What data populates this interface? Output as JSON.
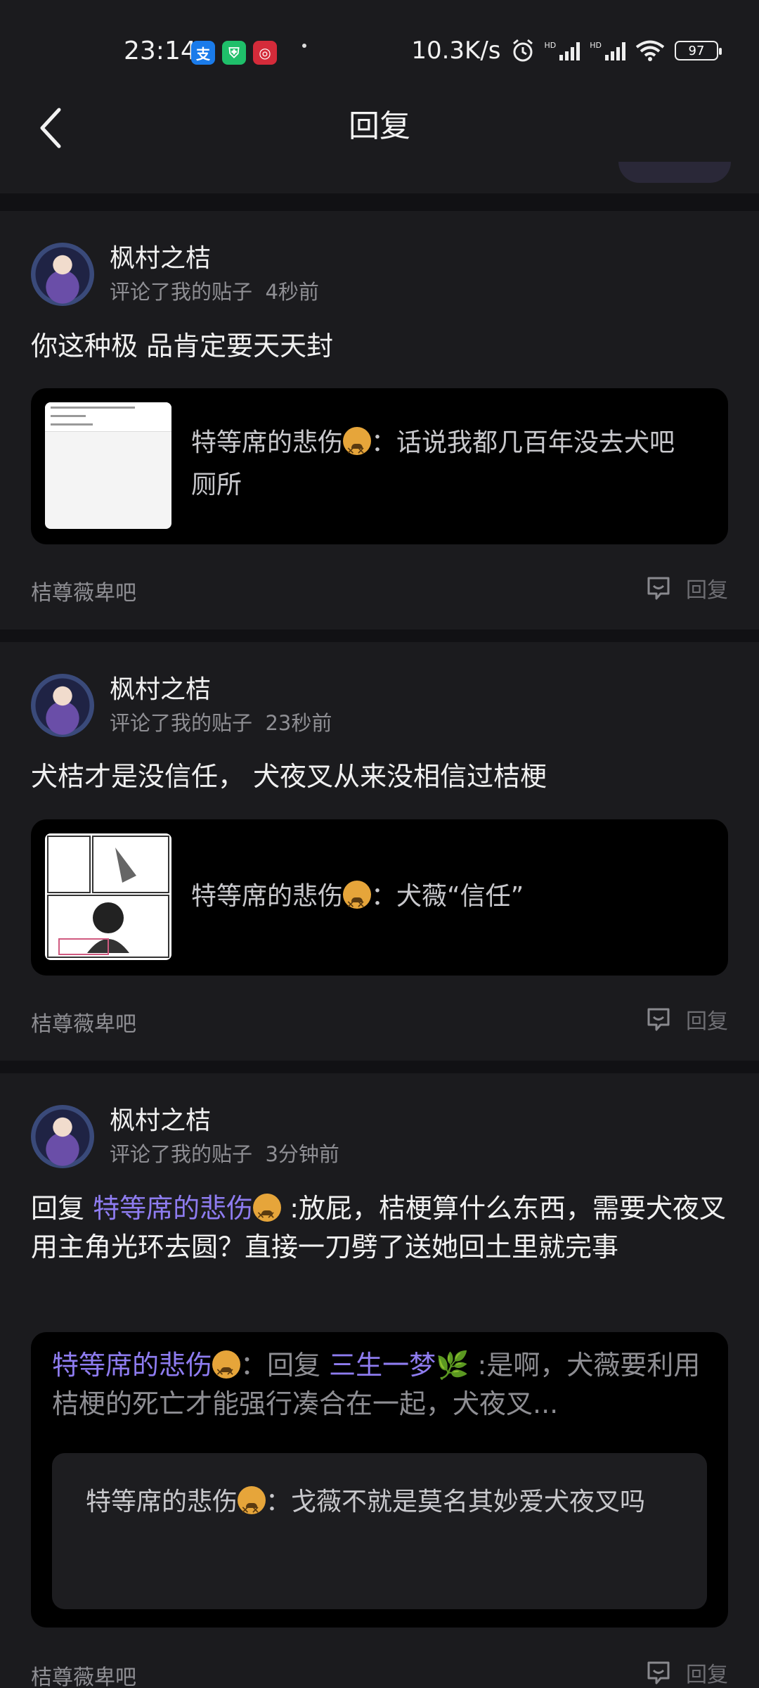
{
  "status_bar": {
    "time": "23:14",
    "speed": "10.3K/s",
    "battery": "97",
    "app_icons": [
      "alipay-icon",
      "shield-icon",
      "game-icon"
    ]
  },
  "header": {
    "title": "回复"
  },
  "cards": [
    {
      "username": "枫村之桔",
      "action": "评论了我的贴子",
      "time": "4秒前",
      "comment": "你这种极 品肯定要天天封",
      "quote_author": "特等席的悲伤",
      "quote_text": "：话说我都几百年没去犬吧厕所",
      "forum": "桔尊薇卑吧",
      "reply_label": "回复"
    },
    {
      "username": "枫村之桔",
      "action": "评论了我的贴子",
      "time": "23秒前",
      "comment": "犬桔才是没信任， 犬夜叉从来没相信过桔梗",
      "quote_author": "特等席的悲伤",
      "quote_text": "：犬薇“信任”",
      "forum": "桔尊薇卑吧",
      "reply_label": "回复"
    },
    {
      "username": "枫村之桔",
      "action": "评论了我的贴子",
      "time": "3分钟前",
      "comment_prefix": "回复 ",
      "comment_mention": "特等席的悲伤",
      "comment_text": " :放屁，桔梗算什么东西，需要犬夜叉用主角光环去圆？直接一刀劈了送她回土里就完事",
      "ref_author": "特等席的悲伤",
      "ref_reply": "：回复 ",
      "ref_mention": "三生一梦🌿",
      "ref_text": " :是啊，犬薇要利用桔梗的死亡才能强行凑合在一起，犬夜叉...",
      "inner_author": "特等席的悲伤",
      "inner_text": "：戈薇不就是莫名其妙爱犬夜叉吗",
      "forum": "桔尊薇卑吧",
      "reply_label": "回复"
    }
  ],
  "colors": {
    "mention": "#8e7cf0",
    "background": "#1b1b1e",
    "divider": "#000000"
  }
}
